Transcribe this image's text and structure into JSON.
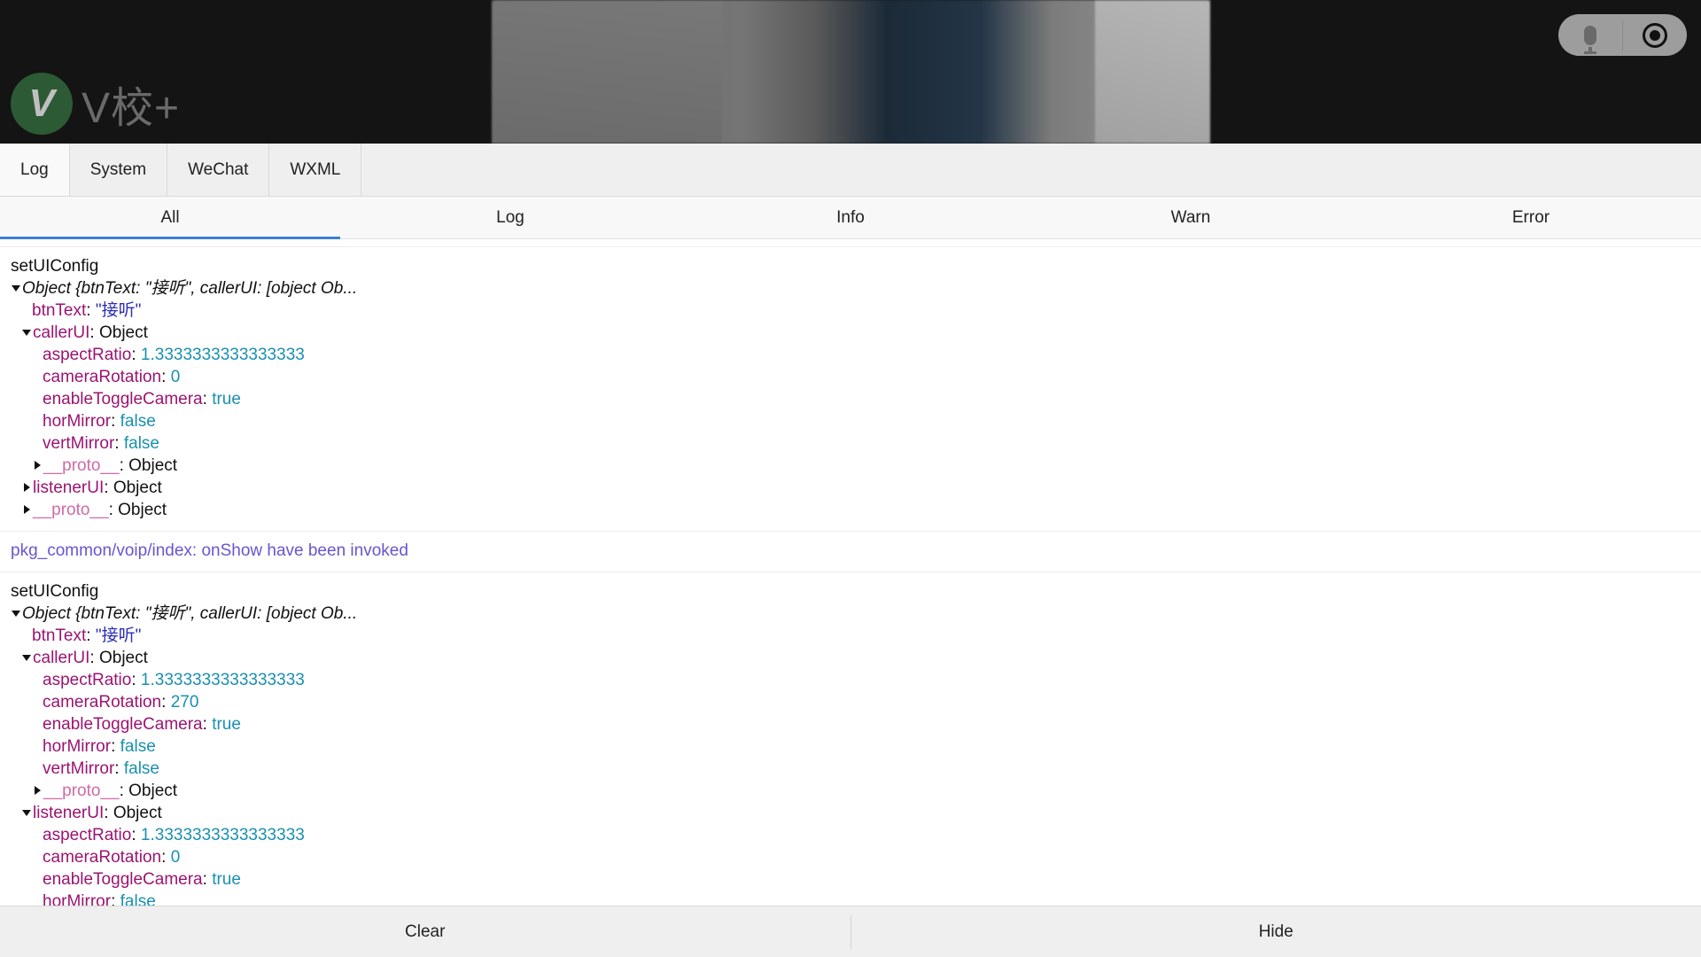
{
  "brand": {
    "mark": "V",
    "name": "V校+"
  },
  "controls": {
    "mic": "microphone-icon",
    "record": "record-icon"
  },
  "tabs": [
    {
      "label": "Log",
      "active": true
    },
    {
      "label": "System",
      "active": false
    },
    {
      "label": "WeChat",
      "active": false
    },
    {
      "label": "WXML",
      "active": false
    }
  ],
  "subtabs": [
    {
      "label": "All",
      "active": true
    },
    {
      "label": "Log",
      "active": false
    },
    {
      "label": "Info",
      "active": false
    },
    {
      "label": "Warn",
      "active": false
    },
    {
      "label": "Error",
      "active": false
    }
  ],
  "entries": [
    {
      "type": "log",
      "title": "setUIConfig",
      "lines": [
        {
          "indent": 0,
          "caret": "down",
          "summary": "Object {btnText: \"接听\", callerUI: [object Ob..."
        },
        {
          "indent": 1,
          "caret": "none",
          "key": "btnText",
          "value": "\"接听\"",
          "vtype": "str"
        },
        {
          "indent": 1,
          "caret": "down",
          "key": "callerUI",
          "value": "Object",
          "vtype": "obj"
        },
        {
          "indent": 2,
          "caret": "none",
          "key": "aspectRatio",
          "value": "1.3333333333333333",
          "vtype": "num"
        },
        {
          "indent": 2,
          "caret": "none",
          "key": "cameraRotation",
          "value": "0",
          "vtype": "num"
        },
        {
          "indent": 2,
          "caret": "none",
          "key": "enableToggleCamera",
          "value": "true",
          "vtype": "num"
        },
        {
          "indent": 2,
          "caret": "none",
          "key": "horMirror",
          "value": "false",
          "vtype": "num"
        },
        {
          "indent": 2,
          "caret": "none",
          "key": "vertMirror",
          "value": "false",
          "vtype": "num"
        },
        {
          "indent": 2,
          "caret": "right",
          "key": "__proto__",
          "value": "Object",
          "vtype": "obj",
          "proto": true
        },
        {
          "indent": 1,
          "caret": "right",
          "key": "listenerUI",
          "value": "Object",
          "vtype": "obj"
        },
        {
          "indent": 1,
          "caret": "right",
          "key": "__proto__",
          "value": "Object",
          "vtype": "obj",
          "proto": true
        }
      ]
    },
    {
      "type": "info",
      "title": "pkg_common/voip/index: onShow have been invoked",
      "lines": []
    },
    {
      "type": "log",
      "title": "setUIConfig",
      "lines": [
        {
          "indent": 0,
          "caret": "down",
          "summary": "Object {btnText: \"接听\", callerUI: [object Ob..."
        },
        {
          "indent": 1,
          "caret": "none",
          "key": "btnText",
          "value": "\"接听\"",
          "vtype": "str"
        },
        {
          "indent": 1,
          "caret": "down",
          "key": "callerUI",
          "value": "Object",
          "vtype": "obj"
        },
        {
          "indent": 2,
          "caret": "none",
          "key": "aspectRatio",
          "value": "1.3333333333333333",
          "vtype": "num"
        },
        {
          "indent": 2,
          "caret": "none",
          "key": "cameraRotation",
          "value": "270",
          "vtype": "num"
        },
        {
          "indent": 2,
          "caret": "none",
          "key": "enableToggleCamera",
          "value": "true",
          "vtype": "num"
        },
        {
          "indent": 2,
          "caret": "none",
          "key": "horMirror",
          "value": "false",
          "vtype": "num"
        },
        {
          "indent": 2,
          "caret": "none",
          "key": "vertMirror",
          "value": "false",
          "vtype": "num"
        },
        {
          "indent": 2,
          "caret": "right",
          "key": "__proto__",
          "value": "Object",
          "vtype": "obj",
          "proto": true
        },
        {
          "indent": 1,
          "caret": "down",
          "key": "listenerUI",
          "value": "Object",
          "vtype": "obj"
        },
        {
          "indent": 2,
          "caret": "none",
          "key": "aspectRatio",
          "value": "1.3333333333333333",
          "vtype": "num"
        },
        {
          "indent": 2,
          "caret": "none",
          "key": "cameraRotation",
          "value": "0",
          "vtype": "num"
        },
        {
          "indent": 2,
          "caret": "none",
          "key": "enableToggleCamera",
          "value": "true",
          "vtype": "num"
        },
        {
          "indent": 2,
          "caret": "none",
          "key": "horMirror",
          "value": "false",
          "vtype": "num"
        }
      ]
    }
  ],
  "footer": {
    "clear": "Clear",
    "hide": "Hide"
  }
}
